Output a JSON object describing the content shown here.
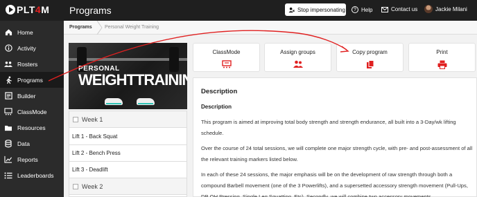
{
  "header": {
    "logo": {
      "pre": "PLT",
      "accent": "4",
      "post": "M"
    },
    "page_title": "Programs",
    "stop_label": "Stop impersonating",
    "help_label": "Help",
    "contact_label": "Contact us",
    "user_name": "Jackie Milani"
  },
  "sidebar": {
    "items": [
      {
        "label": "Home",
        "icon": "home-icon"
      },
      {
        "label": "Activity",
        "icon": "activity-icon"
      },
      {
        "label": "Rosters",
        "icon": "users-icon"
      },
      {
        "label": "Programs",
        "icon": "runner-icon",
        "active": true
      },
      {
        "label": "Builder",
        "icon": "builder-icon"
      },
      {
        "label": "ClassMode",
        "icon": "classmode-icon"
      },
      {
        "label": "Resources",
        "icon": "folder-icon"
      },
      {
        "label": "Data",
        "icon": "database-icon"
      },
      {
        "label": "Reports",
        "icon": "chart-icon"
      },
      {
        "label": "Leaderboards",
        "icon": "list-icon"
      }
    ]
  },
  "breadcrumb": {
    "root": "Programs",
    "current": "Personal Weight Training"
  },
  "program_image": {
    "line1": "PERSONAL",
    "line2": "WEIGHTTRAINING"
  },
  "weeks": {
    "week1": "Week 1",
    "lifts": [
      "Lift 1 - Back Squat",
      "Lift 2 - Bench Press",
      "Lift 3 - Deadlift"
    ],
    "week2": "Week 2"
  },
  "actions": {
    "classmode": "ClassMode",
    "assign": "Assign groups",
    "copy": "Copy program",
    "print": "Print"
  },
  "description": {
    "title": "Description",
    "subtitle": "Description",
    "p1": "This program is aimed at improving total body strength and strength endurance, all built into a 3-Day/wk lifting schedule.",
    "p2": "Over the course of 24 total sessions, we will complete one major strength cycle, with pre- and post-assessment of all the relevant training markers listed below.",
    "p3": "In each of these 24 sessions, the major emphasis will be on the development of raw strength through both a compound Barbell movement (one of the 3 Powerlifts), and a supersetted accessory strength movement (Pull-Ups, DB OH Pressing, Single Leg Squatting, Etc). Secondly, we will combine two accessory movements"
  },
  "colors": {
    "accent": "#e02020",
    "sidebar": "#2b2b2b",
    "topbar": "#1f1f1f"
  }
}
